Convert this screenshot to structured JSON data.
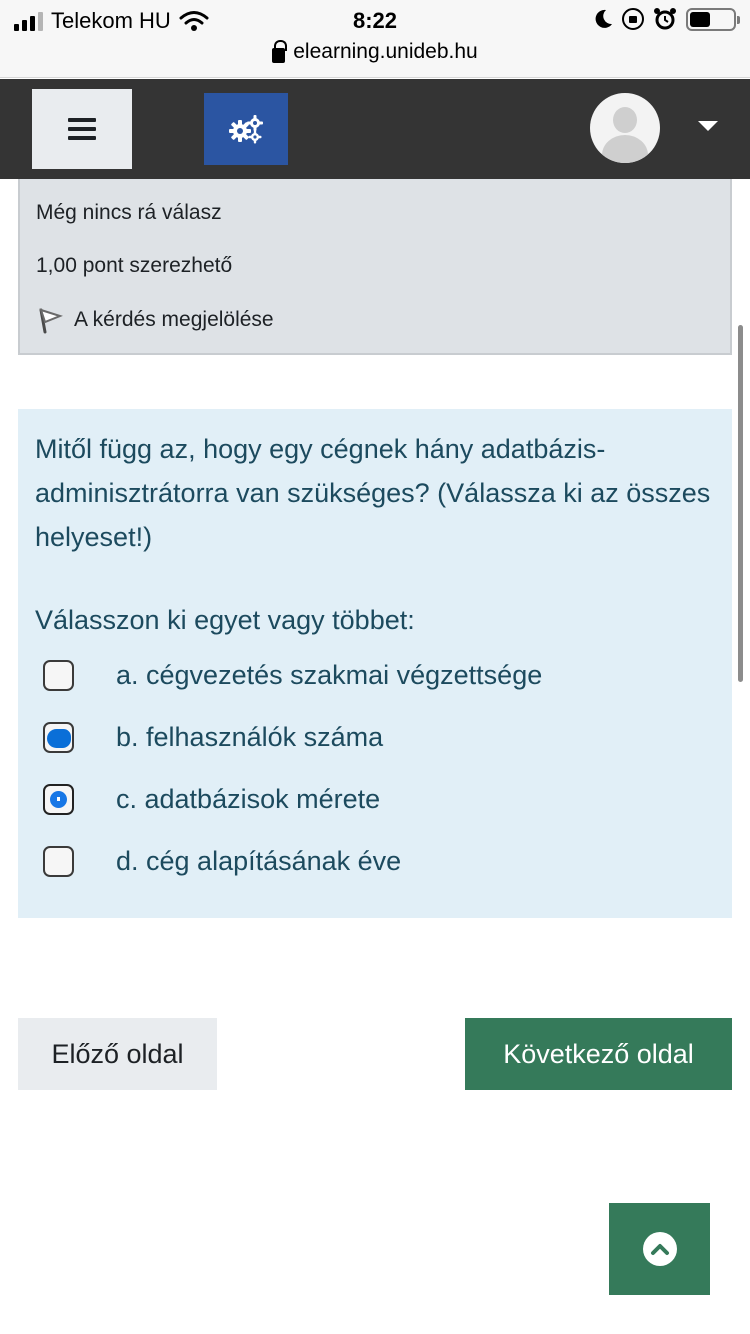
{
  "status_bar": {
    "carrier": "Telekom HU",
    "time": "8:22",
    "url": "elearning.unideb.hu"
  },
  "navbar": {
    "menu_icon": "hamburger-icon",
    "settings_icon": "cogs-icon",
    "avatar_icon": "user-avatar-icon",
    "dropdown_icon": "caret-down-icon"
  },
  "question_info": {
    "state": "Még nincs rá válasz",
    "marks": "1,00 pont szerezhető",
    "flag_label": "A kérdés megjelölése",
    "flag_icon": "flag-icon"
  },
  "question": {
    "text": "Mitől függ az, hogy egy cégnek hány adatbázis-adminisztrátorra van szükséges? (Válassza ki az összes helyeset!)",
    "prompt": "Válasszon ki egyet vagy többet:",
    "options": [
      {
        "label": "a. cégvezetés szakmai végzettsége",
        "checked": false
      },
      {
        "label": "b. felhasználók száma",
        "checked": true
      },
      {
        "label": "c. adatbázisok mérete",
        "checked": true
      },
      {
        "label": "d. cég alapításának éve",
        "checked": false
      }
    ]
  },
  "navigation": {
    "prev_label": "Előző oldal",
    "next_label": "Következő oldal",
    "back_to_top_icon": "chevron-up-circle-icon"
  },
  "colors": {
    "navbar_bg": "#343434",
    "settings_button": "#2b55a2",
    "question_bg": "#e1eff7",
    "question_text": "#1c4a5e",
    "info_bg": "#dee2e6",
    "primary_green": "#357a5a",
    "checkbox_blue": "#0a6fd8"
  }
}
